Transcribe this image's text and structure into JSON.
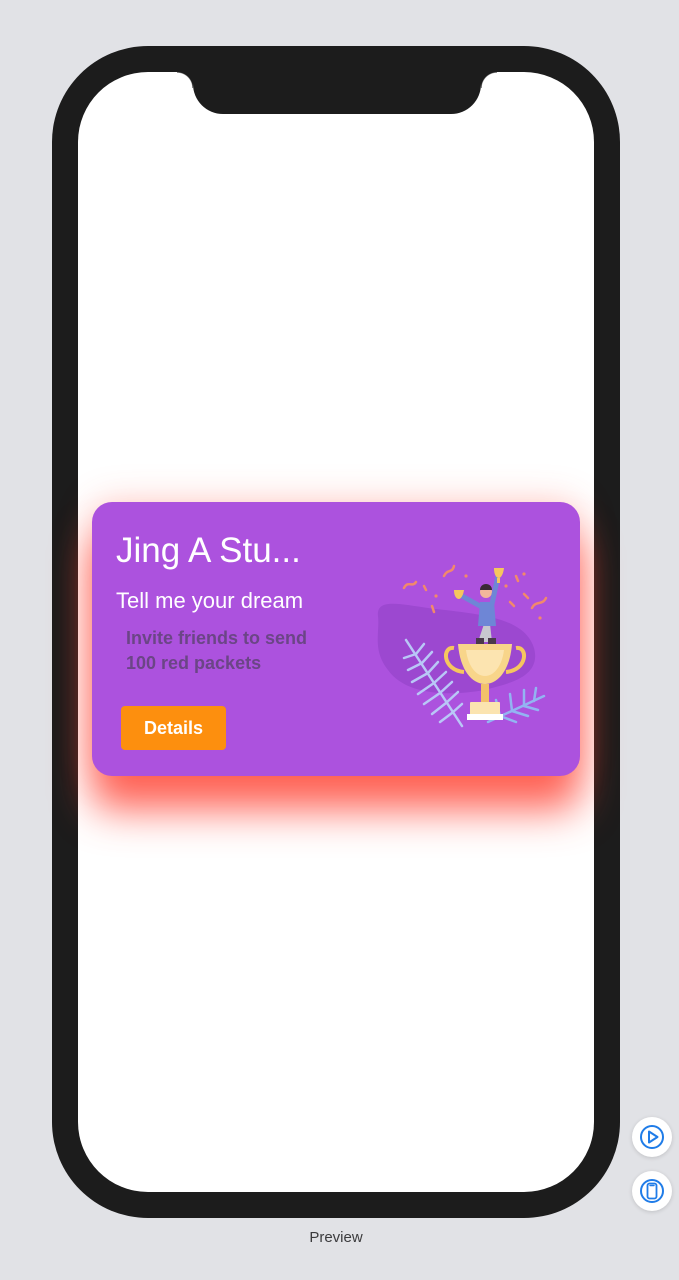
{
  "card": {
    "title": "Jing A Stu...",
    "subtitle": "Tell me your dream",
    "description": "Invite friends to send 100 red packets",
    "button_label": "Details",
    "background_color": "#ac52de",
    "button_color": "#fd8f0e",
    "shadow_color": "#ff3c2d",
    "illustration": "trophy-celebration-illustration"
  },
  "canvas": {
    "preview_label": "Preview",
    "play_button_icon": "play-icon",
    "device_button_icon": "device-icon",
    "background_color": "#e1e2e6"
  },
  "device": {
    "frame_color": "#1c1c1c",
    "screen_color": "#ffffff"
  }
}
